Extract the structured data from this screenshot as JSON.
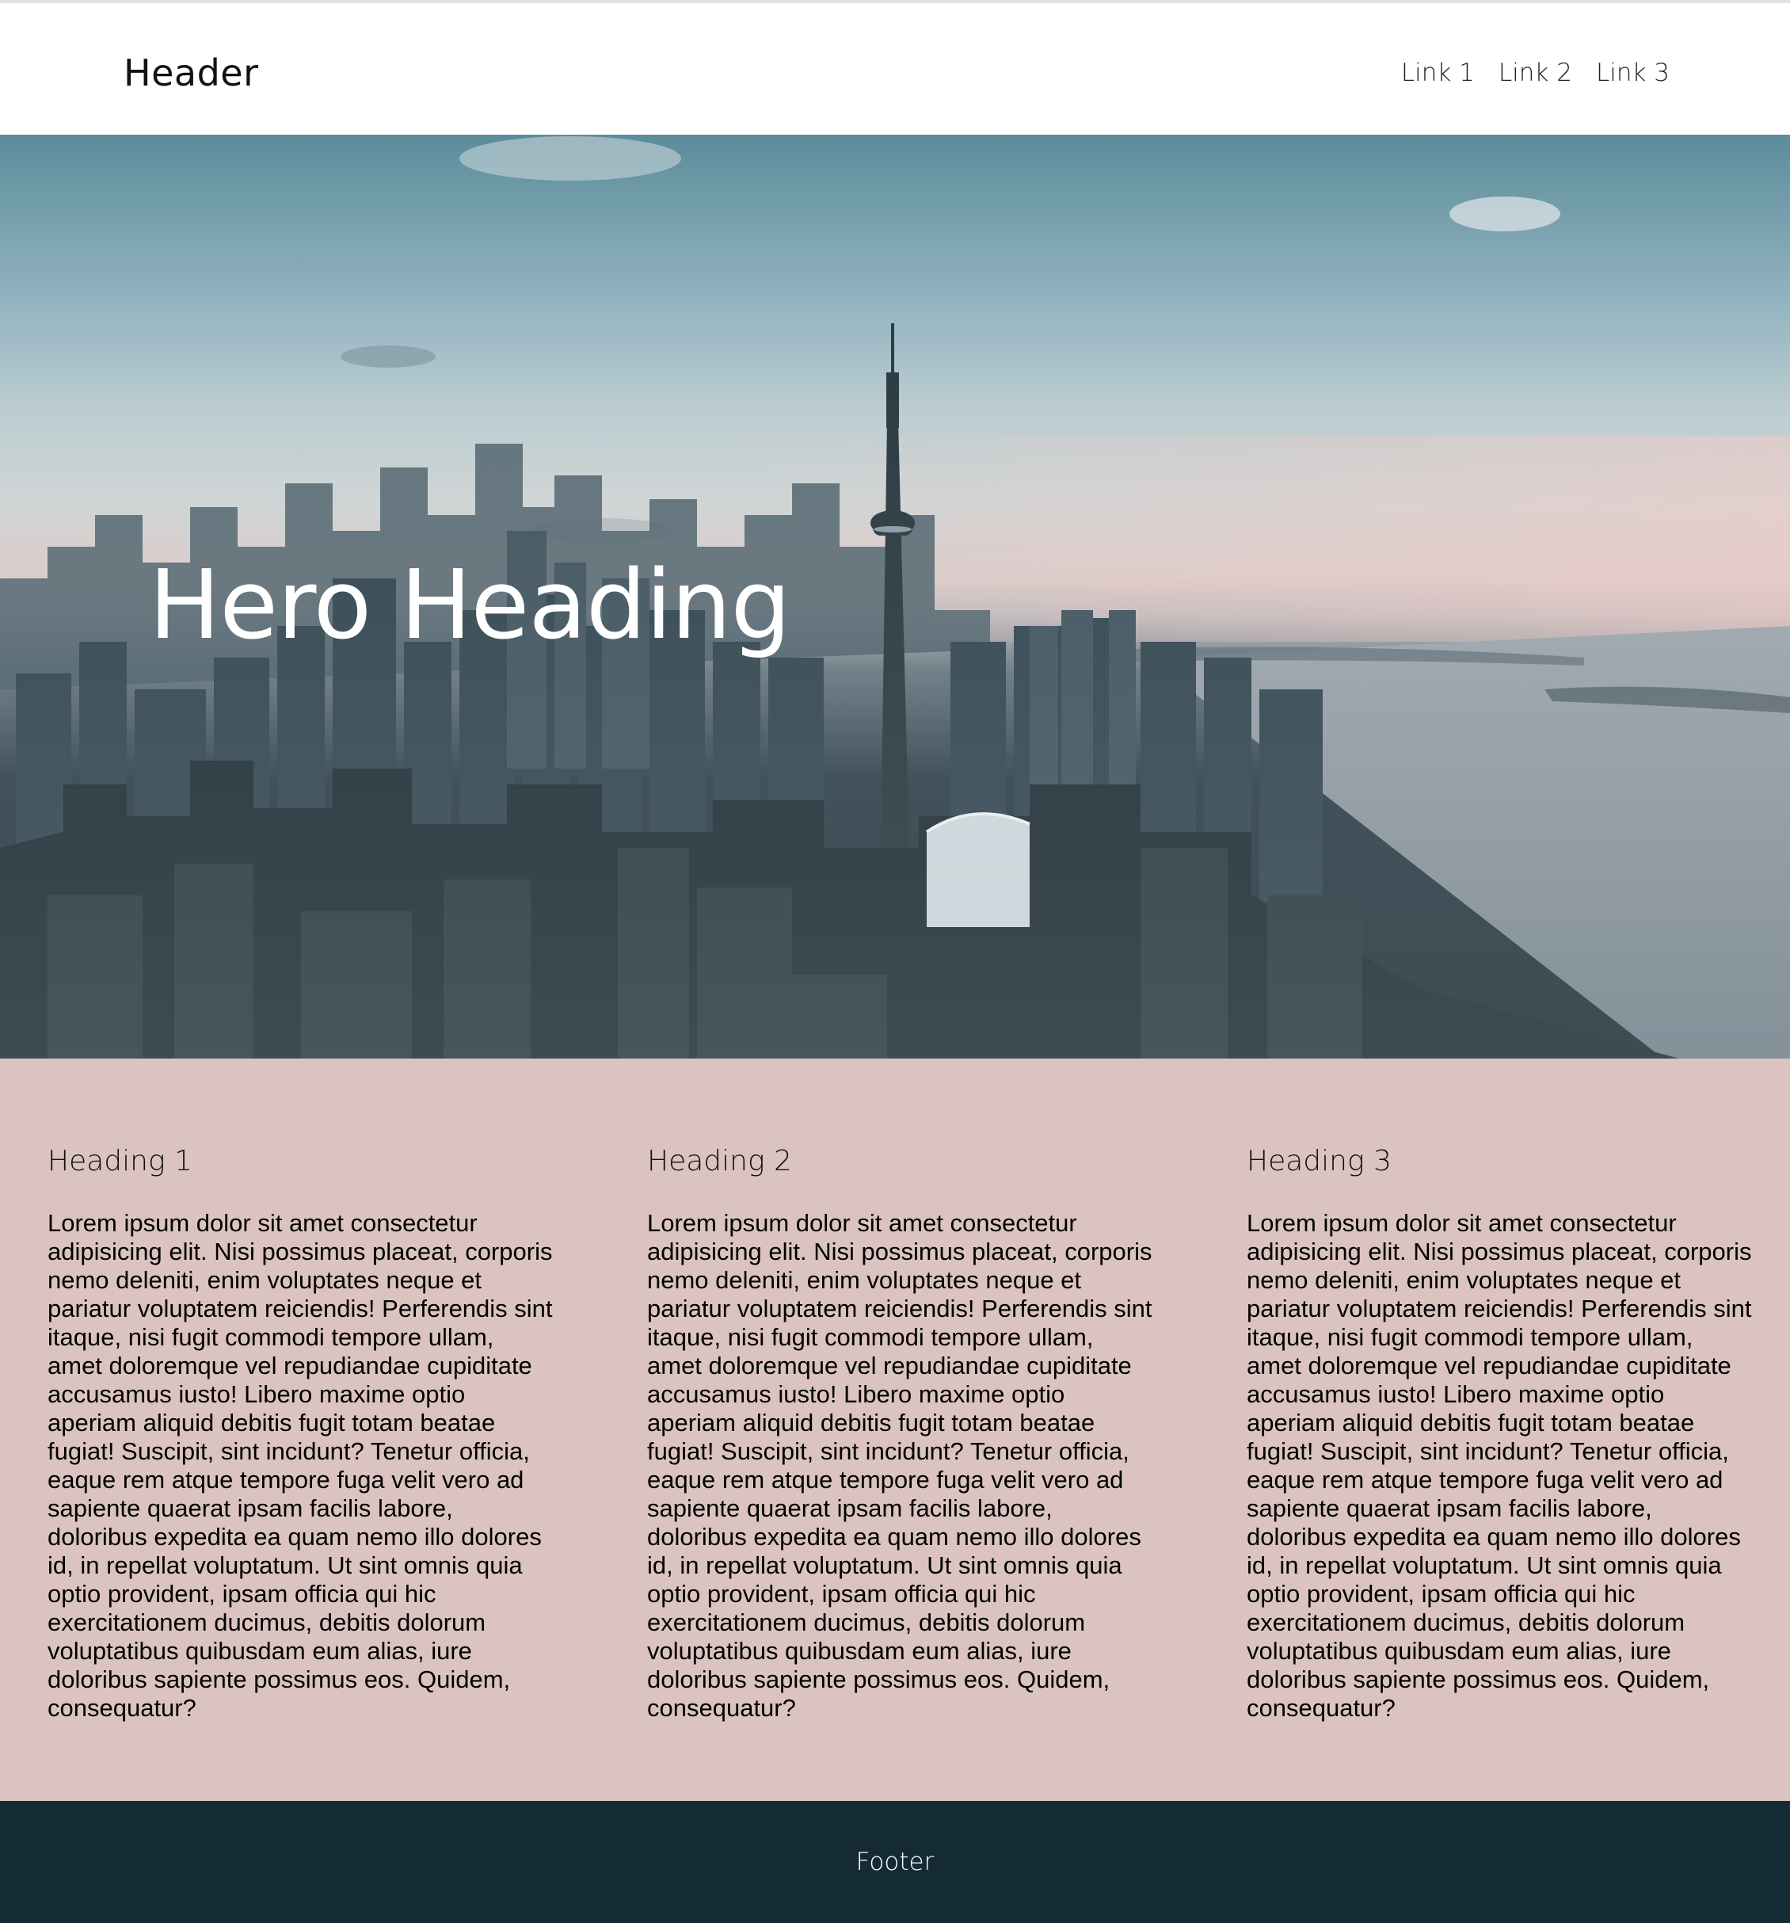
{
  "header": {
    "title": "Header",
    "links": [
      "Link 1",
      "Link 2",
      "Link 3"
    ]
  },
  "hero": {
    "heading": "Hero Heading"
  },
  "columns": [
    {
      "heading": "Heading 1",
      "body": "Lorem ipsum dolor sit amet consectetur adipisicing elit. Nisi possimus placeat, corporis nemo deleniti, enim voluptates neque et pariatur voluptatem reiciendis! Perferendis sint itaque, nisi fugit commodi tempore ullam, amet doloremque vel repudiandae cupiditate accusamus iusto! Libero maxime optio aperiam aliquid debitis fugit totam beatae fugiat! Suscipit, sint incidunt? Tenetur officia, eaque rem atque tempore fuga velit vero ad sapiente quaerat ipsam facilis labore, doloribus expedita ea quam nemo illo dolores id, in repellat voluptatum. Ut sint omnis quia optio provident, ipsam officia qui hic exercitationem ducimus, debitis dolorum voluptatibus quibusdam eum alias, iure doloribus sapiente possimus eos. Quidem, consequatur?"
    },
    {
      "heading": "Heading 2",
      "body": "Lorem ipsum dolor sit amet consectetur adipisicing elit. Nisi possimus placeat, corporis nemo deleniti, enim voluptates neque et pariatur voluptatem reiciendis! Perferendis sint itaque, nisi fugit commodi tempore ullam, amet doloremque vel repudiandae cupiditate accusamus iusto! Libero maxime optio aperiam aliquid debitis fugit totam beatae fugiat! Suscipit, sint incidunt? Tenetur officia, eaque rem atque tempore fuga velit vero ad sapiente quaerat ipsam facilis labore, doloribus expedita ea quam nemo illo dolores id, in repellat voluptatum. Ut sint omnis quia optio provident, ipsam officia qui hic exercitationem ducimus, debitis dolorum voluptatibus quibusdam eum alias, iure doloribus sapiente possimus eos. Quidem, consequatur?"
    },
    {
      "heading": "Heading 3",
      "body": "Lorem ipsum dolor sit amet consectetur adipisicing elit. Nisi possimus placeat, corporis nemo deleniti, enim voluptates neque et pariatur voluptatem reiciendis! Perferendis sint itaque, nisi fugit commodi tempore ullam, amet doloremque vel repudiandae cupiditate accusamus iusto! Libero maxime optio aperiam aliquid debitis fugit totam beatae fugiat! Suscipit, sint incidunt? Tenetur officia, eaque rem atque tempore fuga velit vero ad sapiente quaerat ipsam facilis labore, doloribus expedita ea quam nemo illo dolores id, in repellat voluptatum. Ut sint omnis quia optio provident, ipsam officia qui hic exercitationem ducimus, debitis dolorum voluptatibus quibusdam eum alias, iure doloribus sapiente possimus eos. Quidem, consequatur?"
    }
  ],
  "footer": {
    "text": "Footer"
  },
  "colors": {
    "content_background": "#dbc4bf",
    "footer_background": "#152b34",
    "hero_text": "#ffffff"
  }
}
